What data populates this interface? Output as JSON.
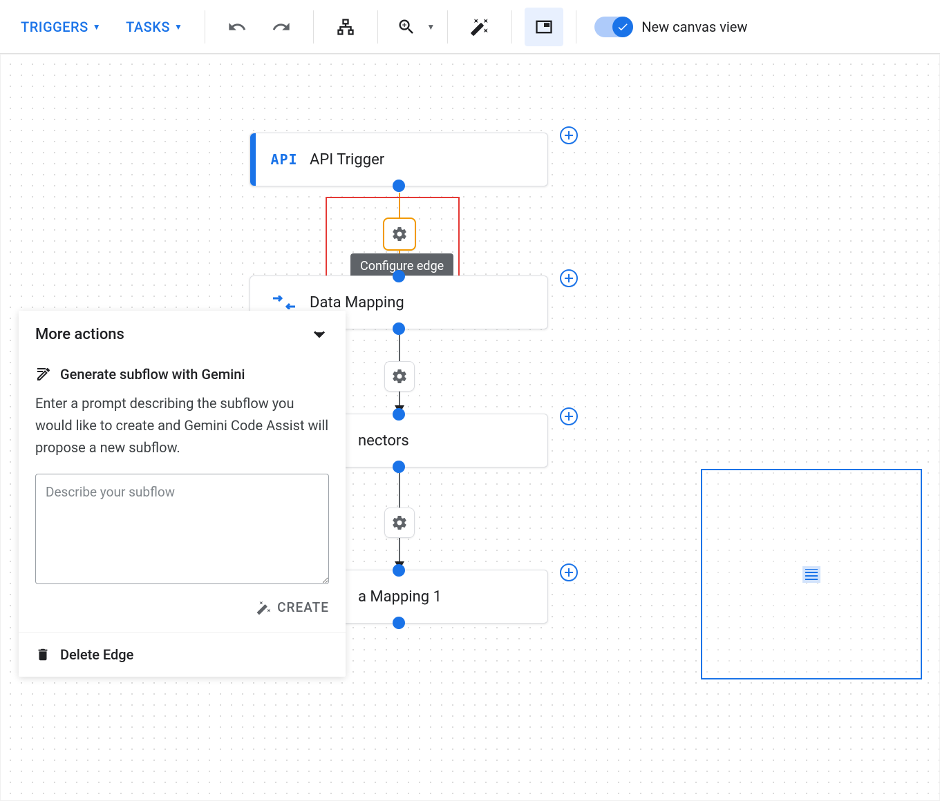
{
  "toolbar": {
    "triggers_label": "TRIGGERS",
    "tasks_label": "TASKS",
    "toggle_label": "New canvas view"
  },
  "nodes": [
    {
      "id": "api-trigger",
      "label": "API Trigger",
      "icon_text": "API"
    },
    {
      "id": "data-mapping",
      "label": "Data Mapping"
    },
    {
      "id": "connectors",
      "label": "nectors"
    },
    {
      "id": "data-mapping-1",
      "label": "a Mapping 1"
    }
  ],
  "tooltip": {
    "configure_edge": "Configure edge"
  },
  "panel": {
    "title": "More actions",
    "gemini_title": "Generate subflow with Gemini",
    "gemini_desc": "Enter a prompt describing the subflow you would like to create and Gemini Code Assist will propose a new subflow.",
    "textarea_placeholder": "Describe your subflow",
    "create_label": "CREATE",
    "delete_label": "Delete Edge"
  }
}
